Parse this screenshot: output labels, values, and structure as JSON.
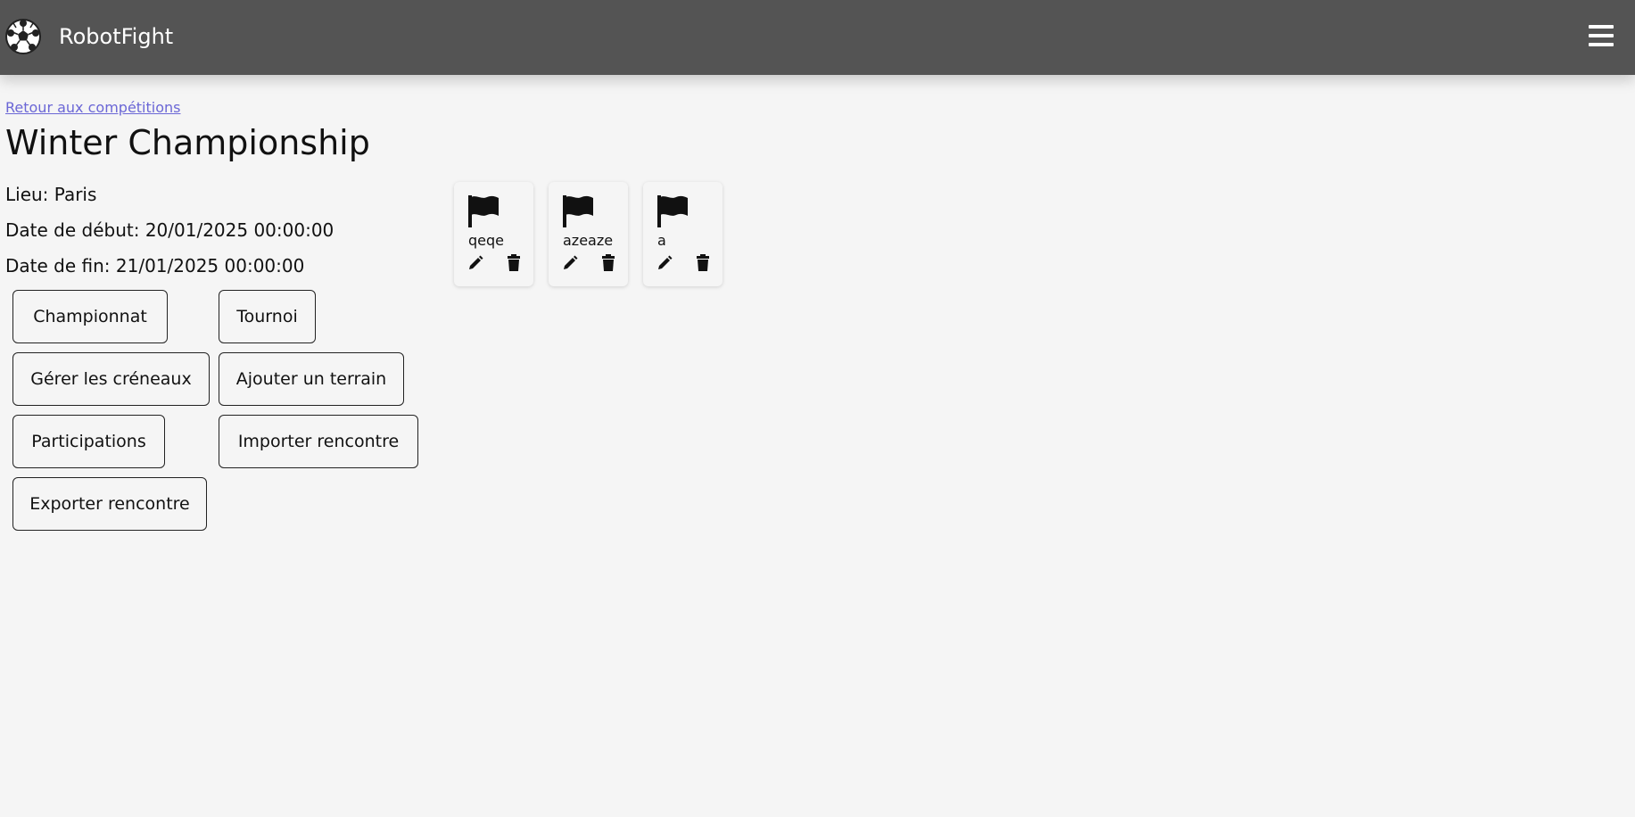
{
  "header": {
    "app_title": "RobotFight",
    "logo_icon": "soccer-ball-icon",
    "menu_icon": "hamburger-menu-icon",
    "background_color": "#545454"
  },
  "back_link": "Retour aux compétitions",
  "competition": {
    "title": "Winter Championship",
    "location": "Lieu: Paris",
    "start_date": "Date de début: 20/01/2025 00:00:00",
    "end_date": "Date de fin: 21/01/2025 00:00:00"
  },
  "actions": {
    "championnat": "Championnat",
    "tournoi": "Tournoi",
    "gerer_creneaux": "Gérer les créneaux",
    "ajouter_terrain": "Ajouter un terrain",
    "participations": "Participations",
    "importer_rencontre": "Importer rencontre",
    "exporter_rencontre": "Exporter rencontre"
  },
  "fields": [
    {
      "name": "qeqe",
      "icon": "flag-icon"
    },
    {
      "name": "azeaze",
      "icon": "flag-icon"
    },
    {
      "name": "a",
      "icon": "flag-icon"
    }
  ],
  "colors": {
    "link": "#6b67d6",
    "page_background": "#f5f5f5"
  }
}
